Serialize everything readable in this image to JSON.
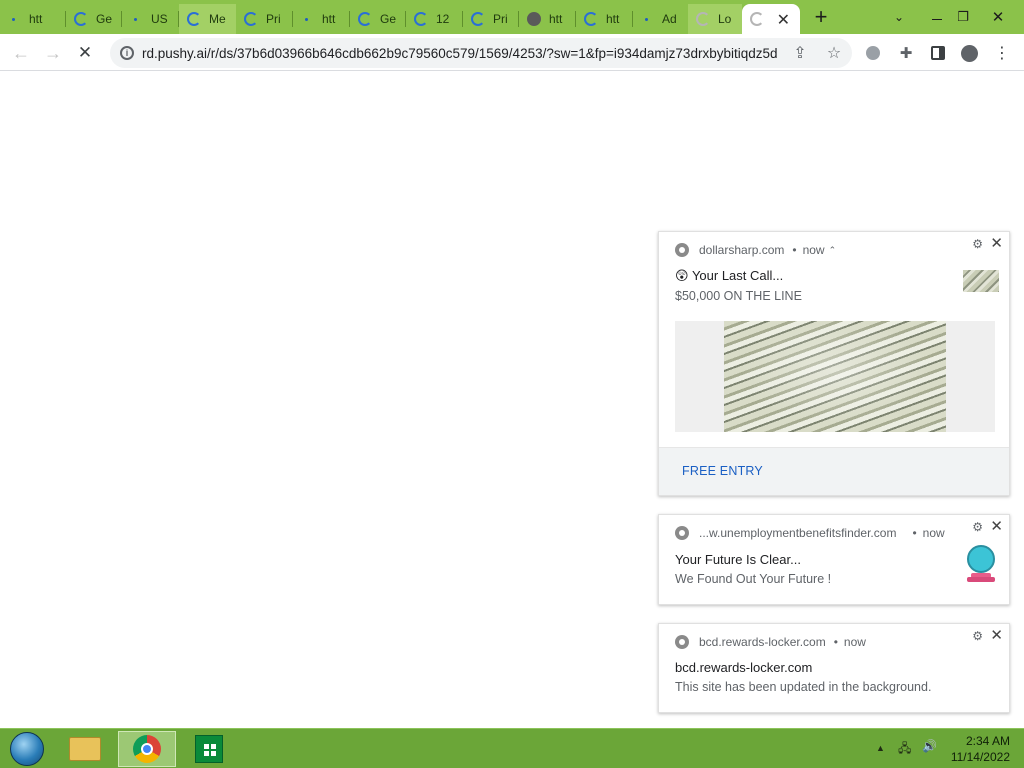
{
  "browser": {
    "tabs": [
      {
        "label": "htt",
        "icon": "loading-dot-icon"
      },
      {
        "label": "Ge",
        "icon": "loading-spinner-icon"
      },
      {
        "label": "US",
        "icon": "loading-dot-icon"
      },
      {
        "label": "Me",
        "icon": "loading-spinner-icon"
      },
      {
        "label": "Pri",
        "icon": "loading-spinner-icon"
      },
      {
        "label": "htt",
        "icon": "loading-dot-icon"
      },
      {
        "label": "Ge",
        "icon": "loading-spinner-icon"
      },
      {
        "label": "12",
        "icon": "loading-spinner-icon"
      },
      {
        "label": "Pri",
        "icon": "loading-spinner-icon"
      },
      {
        "label": "htt",
        "icon": "globe-icon"
      },
      {
        "label": "htt",
        "icon": "loading-spinner-icon"
      },
      {
        "label": "Ad",
        "icon": "loading-dot-icon"
      },
      {
        "label": "Lo",
        "icon": "loading-spinner-icon"
      }
    ],
    "active_tab": {
      "label": "",
      "icon": "loading-spinner-icon"
    },
    "new_tab_icon": "plus-icon",
    "url": "rd.pushy.ai/r/ds/37b6d03966b646cdb662b9c79560c579/1569/4253/?sw=1&fp=i934damjz73drxbybitiqdz5d"
  },
  "notifications": [
    {
      "site": "dollarsharp.com",
      "time": "now",
      "emoji": "😲",
      "title": "Your Last Call...",
      "message": "$50,000 ON THE LINE",
      "action": "FREE ENTRY"
    },
    {
      "site": "...w.unemploymentbenefitsfinder.com",
      "time": "now",
      "title": "Your Future Is Clear...",
      "message": "We Found Out Your Future !"
    },
    {
      "site": "bcd.rewards-locker.com",
      "time": "now",
      "title": "bcd.rewards-locker.com",
      "message": "This site has been updated in the background."
    }
  ],
  "separator": "•",
  "taskbar": {
    "time": "2:34 AM",
    "date": "11/14/2022"
  },
  "colors": {
    "tabstrip": "#8bc24a",
    "taskbar": "#6ba638",
    "link": "#1a5fc4"
  }
}
